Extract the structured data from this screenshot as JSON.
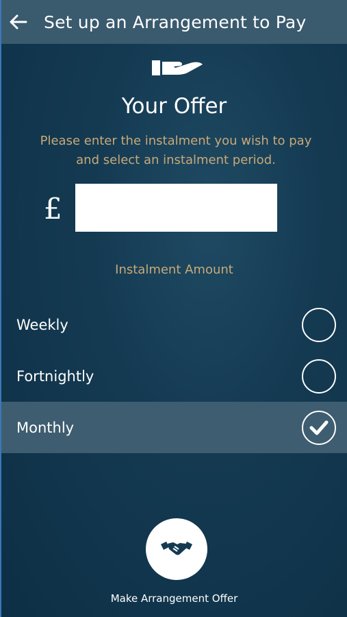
{
  "header": {
    "title": "Set up an Arrangement to Pay",
    "back_icon": "arrow-left-icon"
  },
  "offer": {
    "title": "Your Offer",
    "instructions": "Please enter the instalment you wish to pay and select an instalment period.",
    "currency_symbol": "£",
    "amount_value": "",
    "amount_label": "Instalment Amount"
  },
  "period_options": [
    {
      "label": "Weekly",
      "selected": false
    },
    {
      "label": "Fortnightly",
      "selected": false
    },
    {
      "label": "Monthly",
      "selected": true
    }
  ],
  "submit": {
    "label": "Make Arrangement Offer",
    "icon": "handshake-icon"
  },
  "colors": {
    "header_bg": "#3a5a6e",
    "background": "#143a52",
    "accent_text": "#c9a978",
    "selected_row": "#3f5d70"
  }
}
